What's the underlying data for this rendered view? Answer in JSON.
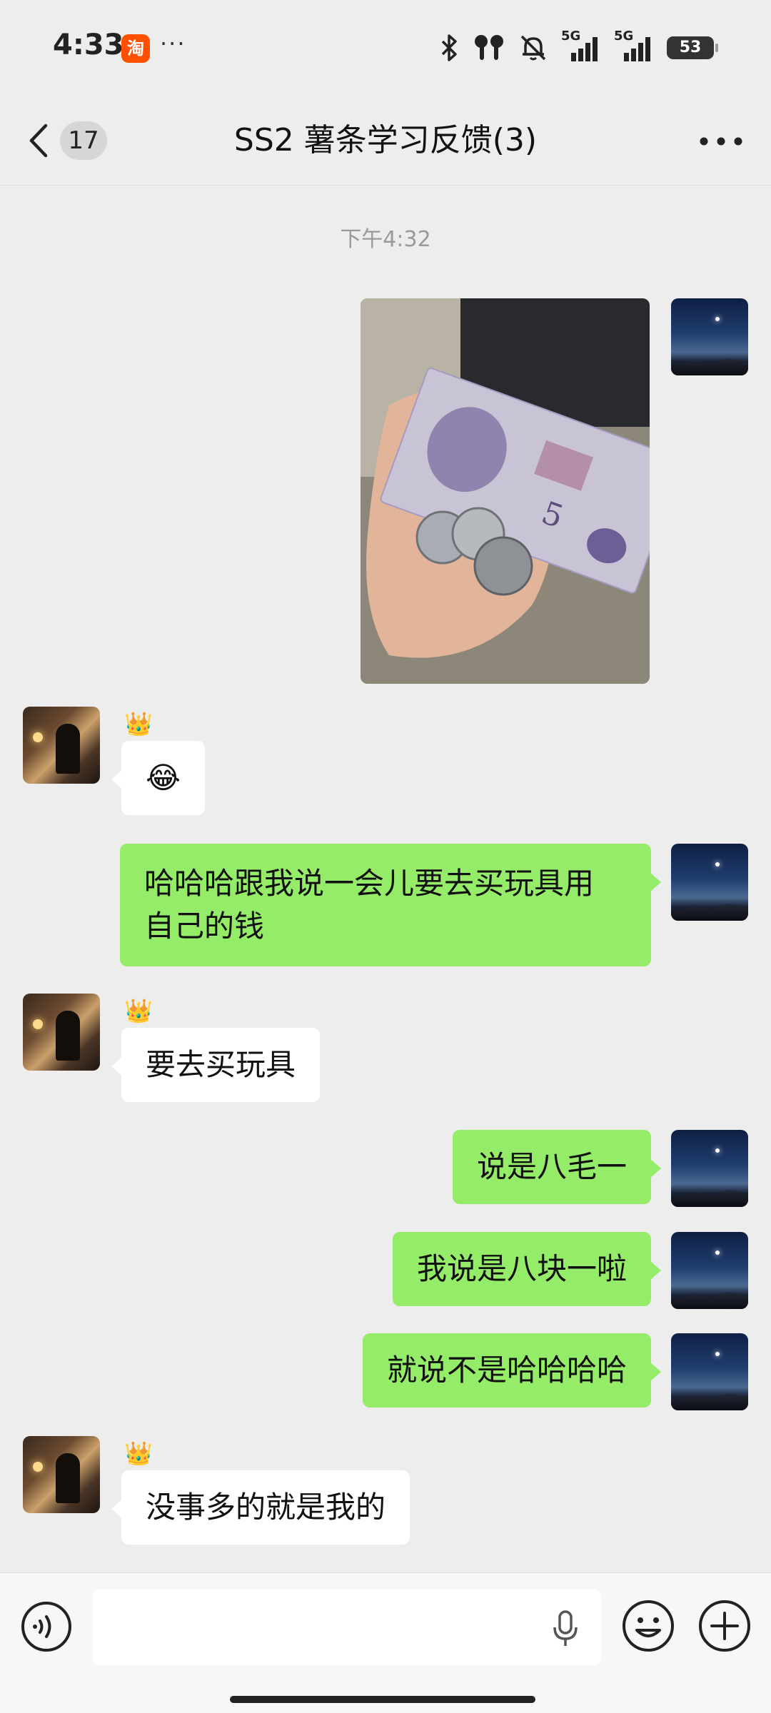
{
  "status_bar": {
    "time": "4:33",
    "app_badge": "淘",
    "more": "···",
    "net1_label": "5G",
    "net2_label": "5G",
    "battery": "53"
  },
  "header": {
    "unread_count": "17",
    "title": "SS2 薯条学习反馈(3)"
  },
  "chat": {
    "timestamp": "下午4:32",
    "messages": [
      {
        "sender": "self",
        "type": "image",
        "icon": "photo-banknote-coins"
      },
      {
        "sender": "other",
        "type": "text",
        "crown": "👑",
        "text": "😂"
      },
      {
        "sender": "self",
        "type": "text",
        "text_line1": "哈哈哈跟我说一会儿要去买玩具用",
        "text_line2": "自己的钱"
      },
      {
        "sender": "other",
        "type": "text",
        "crown": "👑",
        "text": "要去买玩具"
      },
      {
        "sender": "self",
        "type": "text",
        "text": "说是八毛一"
      },
      {
        "sender": "self",
        "type": "text",
        "text": "我说是八块一啦"
      },
      {
        "sender": "self",
        "type": "text",
        "text": "就说不是哈哈哈哈"
      },
      {
        "sender": "other",
        "type": "text",
        "crown": "👑",
        "text": "没事多的就是我的"
      }
    ]
  },
  "photo": {
    "banknote_digit": "5"
  },
  "input_bar": {
    "placeholder": "",
    "value": ""
  },
  "colors": {
    "background": "#ededed",
    "self_bubble": "#95ec69",
    "other_bubble": "#ffffff",
    "timestamp": "#9a9a9a"
  }
}
